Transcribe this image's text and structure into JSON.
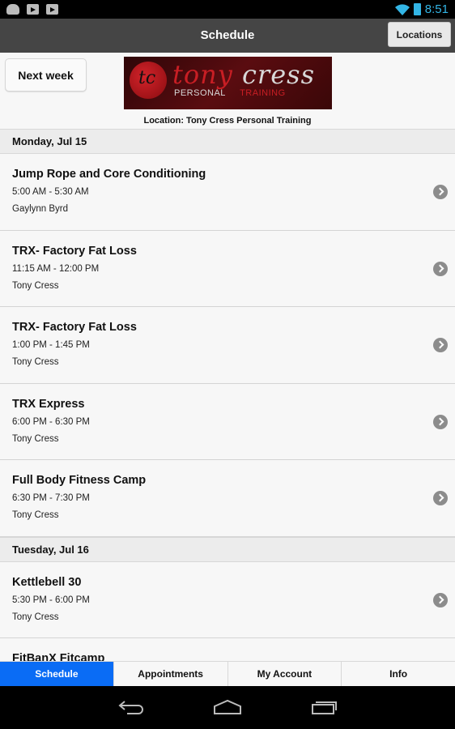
{
  "status_bar": {
    "time": "8:51",
    "icons": [
      "android-icon",
      "play-store-icon",
      "play-store-icon",
      "wifi-icon",
      "battery-charging-icon"
    ]
  },
  "action_bar": {
    "title": "Schedule",
    "locations_button": "Locations"
  },
  "header": {
    "next_week_button": "Next week",
    "logo": {
      "initials": "tc",
      "name_first": "tony",
      "name_last": "cress",
      "sub_left": "PERSONAL",
      "sub_right": "TRAINING"
    },
    "location_text": "Location: Tony Cress Personal Training"
  },
  "schedule": {
    "days": [
      {
        "label": "Monday, Jul 15",
        "events": [
          {
            "title": "Jump Rope and Core Conditioning",
            "time": "5:00 AM - 5:30 AM",
            "instructor": "Gaylynn Byrd"
          },
          {
            "title": "TRX- Factory Fat Loss",
            "time": "11:15 AM - 12:00 PM",
            "instructor": "Tony Cress"
          },
          {
            "title": "TRX- Factory Fat Loss",
            "time": "1:00 PM - 1:45 PM",
            "instructor": "Tony Cress"
          },
          {
            "title": "TRX Express",
            "time": "6:00 PM - 6:30 PM",
            "instructor": "Tony Cress"
          },
          {
            "title": "Full Body Fitness Camp",
            "time": "6:30 PM - 7:30 PM",
            "instructor": "Tony Cress"
          }
        ]
      },
      {
        "label": "Tuesday, Jul 16",
        "events": [
          {
            "title": "Kettlebell 30",
            "time": "5:30 PM - 6:00 PM",
            "instructor": "Tony Cress"
          },
          {
            "title": "FitBanX Fitcamp",
            "time": "",
            "instructor": ""
          }
        ]
      }
    ]
  },
  "tabs": [
    {
      "label": "Schedule",
      "active": true
    },
    {
      "label": "Appointments",
      "active": false
    },
    {
      "label": "My Account",
      "active": false
    },
    {
      "label": "Info",
      "active": false
    }
  ],
  "colors": {
    "accent": "#0a6cf5",
    "action_bar": "#454545",
    "status_accent": "#33b5e5",
    "logo_red": "#c81e24"
  }
}
